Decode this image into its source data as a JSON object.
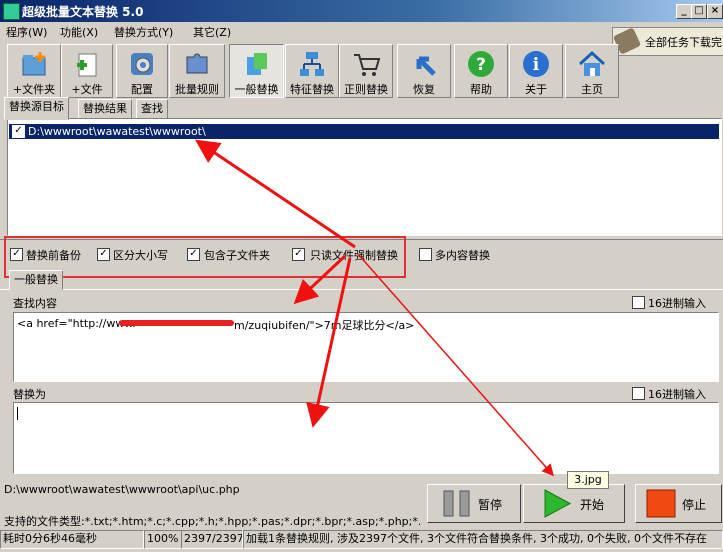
{
  "window": {
    "title": "超级批量文本替换 5.0",
    "min": "_",
    "max": "□",
    "close": "×"
  },
  "menu": [
    "程序(W)",
    "功能(X)",
    "替换方式(Y)",
    "其它(Z)"
  ],
  "notification": "全部任务下载完",
  "toolbar": [
    {
      "label": "+文件夹",
      "icon": "add-folder-icon"
    },
    {
      "label": "+文件",
      "icon": "add-file-icon"
    },
    {
      "label": "配置",
      "icon": "gear-icon"
    },
    {
      "label": "批量规则",
      "icon": "puzzle-icon"
    },
    {
      "label": "一般替换",
      "icon": "replace-icon"
    },
    {
      "label": "特征替换",
      "icon": "tree-icon"
    },
    {
      "label": "正则替换",
      "icon": "cart-icon"
    },
    {
      "label": "恢复",
      "icon": "undo-arrow-icon"
    },
    {
      "label": "帮助",
      "icon": "help-icon"
    },
    {
      "label": "关于",
      "icon": "info-icon"
    },
    {
      "label": "主页",
      "icon": "home-icon"
    }
  ],
  "tabs": [
    "替换源目标",
    "替换结果",
    "查找"
  ],
  "source_list": [
    {
      "path": "D:\\wwwroot\\wawatest\\wwwroot\\",
      "checked": true
    }
  ],
  "options": [
    {
      "label": "替换前备份",
      "checked": true
    },
    {
      "label": "区分大小写",
      "checked": true
    },
    {
      "label": "包含子文件夹",
      "checked": true
    },
    {
      "label": "只读文件强制替换",
      "checked": true
    },
    {
      "label": "多内容替换",
      "checked": false
    }
  ],
  "subtab": "一般替换",
  "find": {
    "label": "查找内容",
    "hex_label": "16进制输入",
    "text_start": "<a href=\"http://www.",
    "text_end": "m/zuqiubifen/\">7m足球比分</a>"
  },
  "replace": {
    "label": "替换为",
    "hex_label": "16进制输入",
    "text": ""
  },
  "current_file": "D:\\wwwroot\\wawatest\\wwwroot\\api\\uc.php",
  "file_types": "支持的文件类型:*.txt;*.htm;*.c;*.cpp;*.h;*.hpp;*.pas;*.dpr;*.bpr;*.asp;*.php;*.cgi;*.ini;*.ba",
  "tooltip": "3.jpg",
  "buttons": {
    "pause": "暂停",
    "start": "开始",
    "stop": "停止"
  },
  "status": {
    "elapsed": "耗时0分6秒46毫秒",
    "percent": "100%",
    "count": "2397/2397",
    "message": "加载1条替换规则, 涉及2397个文件, 3个文件符合替换条件, 3个成功, 0个失败, 0个文件不存在"
  }
}
